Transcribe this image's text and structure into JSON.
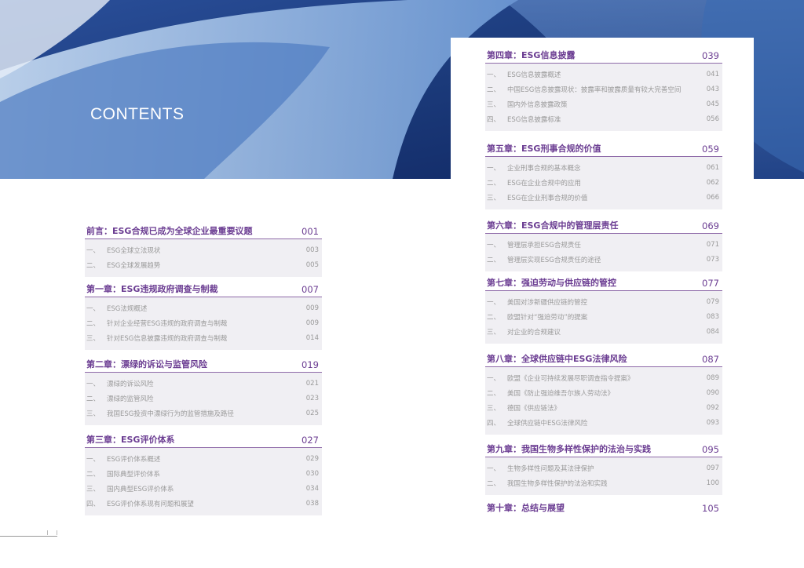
{
  "title": "CONTENTS",
  "colors": {
    "accent": "#6b3d92",
    "item_text": "#9a9a9a",
    "box": "#f0eff3",
    "banner": "#1b3a7a"
  },
  "chapters": [
    {
      "title": "前言：ESG合规已成为全球企业最重要议题",
      "page": "001",
      "items": [
        [
          "一、",
          "ESG全球立法现状",
          "003"
        ],
        [
          "二、",
          "ESG全球发展趋势",
          "005"
        ]
      ]
    },
    {
      "title": "第一章：ESG违规政府调查与制裁",
      "page": "007",
      "items": [
        [
          "一、",
          "ESG法规概述",
          "009"
        ],
        [
          "二、",
          "针对企业经营ESG违规的政府调查与制裁",
          "009"
        ],
        [
          "三、",
          "针对ESG信息披露违规的政府调查与制裁",
          "014"
        ]
      ]
    },
    {
      "title": "第二章：漂绿的诉讼与监管风险",
      "page": "019",
      "items": [
        [
          "一、",
          "漂绿的诉讼风险",
          "021"
        ],
        [
          "二、",
          "漂绿的监管风险",
          "023"
        ],
        [
          "三、",
          "我国ESG投资中漂绿行为的监管措施及路径",
          "025"
        ]
      ]
    },
    {
      "title": "第三章：ESG评价体系",
      "page": "027",
      "items": [
        [
          "一、",
          "ESG评价体系概述",
          "029"
        ],
        [
          "二、",
          "国际典型评价体系",
          "030"
        ],
        [
          "三、",
          "国内典型ESG评价体系",
          "034"
        ],
        [
          "四、",
          "ESG评价体系现有问题和展望",
          "038"
        ]
      ]
    },
    {
      "title": "第四章：ESG信息披露",
      "page": "039",
      "items": [
        [
          "一、",
          "ESG信息披露概述",
          "041"
        ],
        [
          "二、",
          "中国ESG信息披露现状：披露率和披露质量有较大完善空间",
          "043"
        ],
        [
          "三、",
          "国内外信息披露政策",
          "045"
        ],
        [
          "四、",
          "ESG信息披露标准",
          "056"
        ]
      ]
    },
    {
      "title": "第五章：ESG刑事合规的价值",
      "page": "059",
      "items": [
        [
          "一、",
          "企业刑事合规的基本概念",
          "061"
        ],
        [
          "二、",
          "ESG在企业合规中的应用",
          "062"
        ],
        [
          "三、",
          "ESG在企业刑事合规的价值",
          "066"
        ]
      ]
    },
    {
      "title": "第六章：ESG合规中的管理层责任",
      "page": "069",
      "items": [
        [
          "一、",
          "管理层承担ESG合规责任",
          "071"
        ],
        [
          "二、",
          "管理层实现ESG合规责任的途径",
          "073"
        ]
      ]
    },
    {
      "title": "第七章：强迫劳动与供应链的管控",
      "page": "077",
      "items": [
        [
          "一、",
          "美国对涉新疆供应链的管控",
          "079"
        ],
        [
          "二、",
          "欧盟针对“强迫劳动”的提案",
          "083"
        ],
        [
          "三、",
          "对企业的合规建议",
          "084"
        ]
      ]
    },
    {
      "title": "第八章：全球供应链中ESG法律风险",
      "page": "087",
      "items": [
        [
          "一、",
          "欧盟《企业可持续发展尽职调查指令提案》",
          "089"
        ],
        [
          "二、",
          "美国《防止强迫维吾尔族人劳动法》",
          "090"
        ],
        [
          "三、",
          "德国《供应链法》",
          "092"
        ],
        [
          "四、",
          "全球供应链中ESG法律风险",
          "093"
        ]
      ]
    },
    {
      "title": "第九章：我国生物多样性保护的法治与实践",
      "page": "095",
      "items": [
        [
          "一、",
          "生物多样性问题及其法律保护",
          "097"
        ],
        [
          "二、",
          "我国生物多样性保护的法治和实践",
          "100"
        ]
      ]
    },
    {
      "title": "第十章：总结与展望",
      "page": "105",
      "items": []
    }
  ]
}
